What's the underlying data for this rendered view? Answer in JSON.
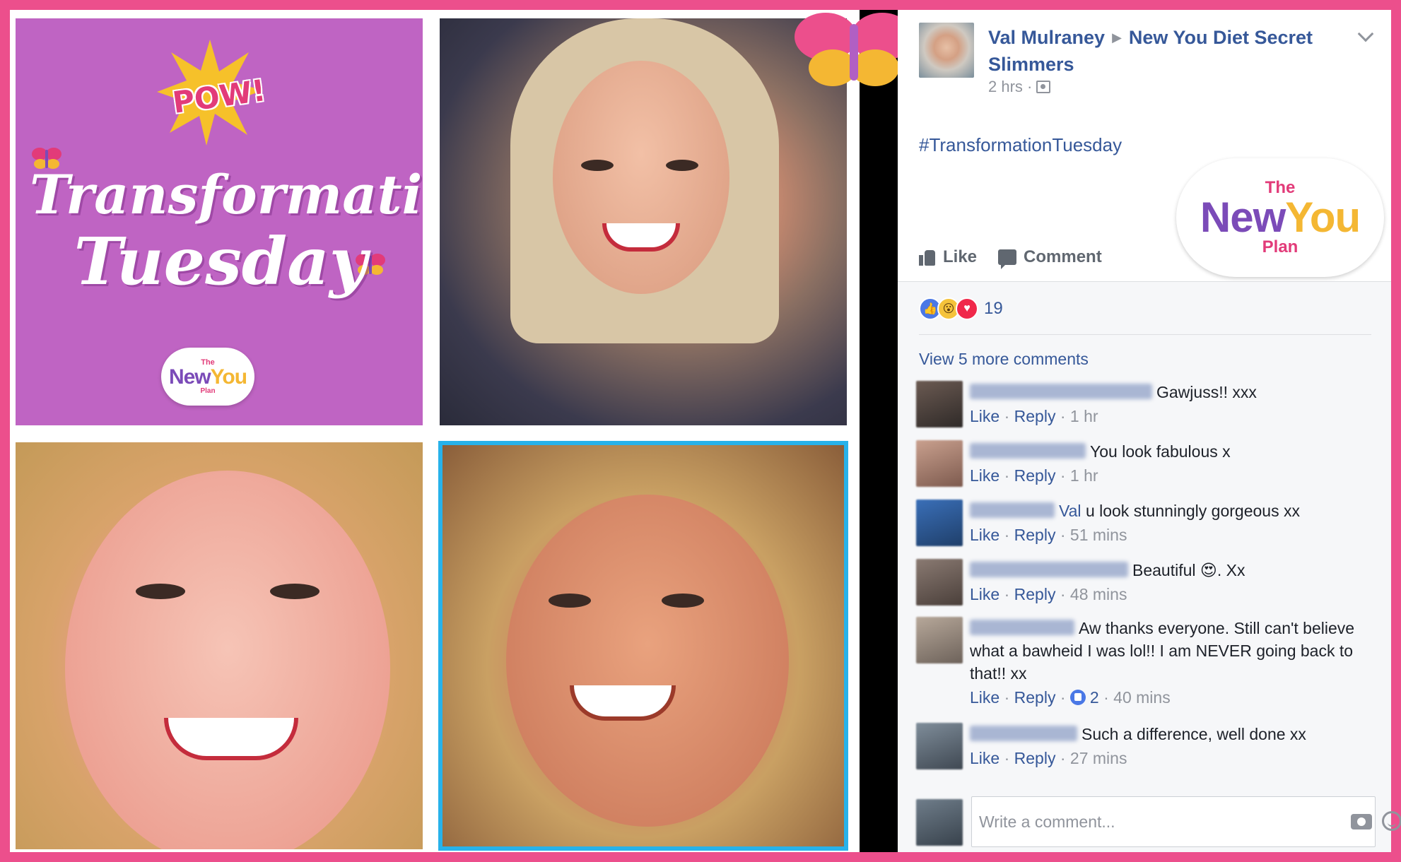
{
  "promo": {
    "pow": "POW!",
    "title_line1": "Transformation",
    "title_line2": "Tuesday",
    "logo": {
      "the": "The",
      "new": "New",
      "you": "You",
      "plan": "Plan"
    }
  },
  "post": {
    "author": "Val Mulraney",
    "group": "New You Diet Secret Slimmers",
    "time": "2 hrs",
    "text": "#TransformationTuesday",
    "logo": {
      "the": "The",
      "new": "New",
      "you": "You",
      "plan": "Plan"
    },
    "actions": {
      "like": "Like",
      "comment": "Comment"
    },
    "reaction_count": "19"
  },
  "comments": {
    "view_more": "View 5 more comments",
    "items": [
      {
        "text": "Gawjuss!! xxx",
        "like": "Like",
        "reply": "Reply",
        "time": "1 hr"
      },
      {
        "text": "You look fabulous x",
        "like": "Like",
        "reply": "Reply",
        "time": "1 hr"
      },
      {
        "mention": "Val",
        "text": "u look stunningly gorgeous xx",
        "like": "Like",
        "reply": "Reply",
        "time": "51 mins"
      },
      {
        "text": "Beautiful 😍. Xx",
        "like": "Like",
        "reply": "Reply",
        "time": "48 mins"
      },
      {
        "text": "Aw thanks everyone. Still can't believe what a bawheid I was lol!! I am NEVER going back to that!! xx",
        "like": "Like",
        "reply": "Reply",
        "likes": "2",
        "time": "40 mins"
      },
      {
        "text": "Such a difference, well done xx",
        "like": "Like",
        "reply": "Reply",
        "time": "27 mins"
      }
    ],
    "placeholder": "Write a comment..."
  },
  "colors": {
    "border_pink": "#ec4f8c",
    "promo_purple": "#bf64c3",
    "fb_link": "#365899",
    "photo_border_blue": "#27b2ea"
  },
  "icons": [
    "butterfly-icon",
    "like-icon",
    "comment-icon",
    "camera-icon",
    "emoji-icon",
    "audience-icon",
    "chevron-down-icon"
  ]
}
